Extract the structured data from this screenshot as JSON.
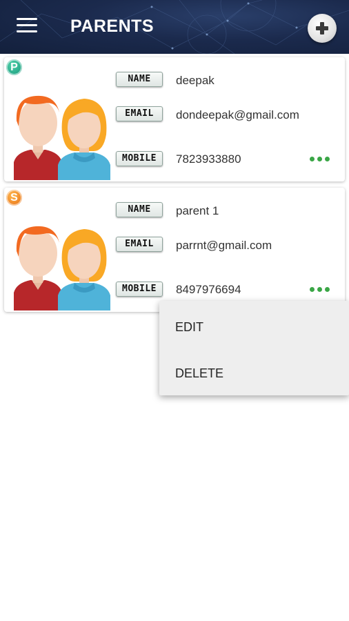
{
  "app_bar": {
    "title": "PARENTS",
    "menu_icon": "hamburger-menu-icon",
    "add_icon": "plus-icon"
  },
  "labels": {
    "name": "NAME",
    "email": "EMAIL",
    "mobile": "MOBILE"
  },
  "parents": [
    {
      "badge": "P",
      "badge_color": "#14957a",
      "name": "deepak",
      "email": "dondeepak@gmail.com",
      "mobile": "7823933880"
    },
    {
      "badge": "S",
      "badge_color": "#e66a10",
      "name": "parent 1",
      "email": "parrnt@gmail.com",
      "mobile": "8497976694"
    }
  ],
  "context_menu": {
    "items": [
      "EDIT",
      "DELETE"
    ]
  },
  "colors": {
    "app_bar": "#1b2a4d",
    "more_dots": "#3aa646",
    "menu_background": "#eeeeee"
  }
}
